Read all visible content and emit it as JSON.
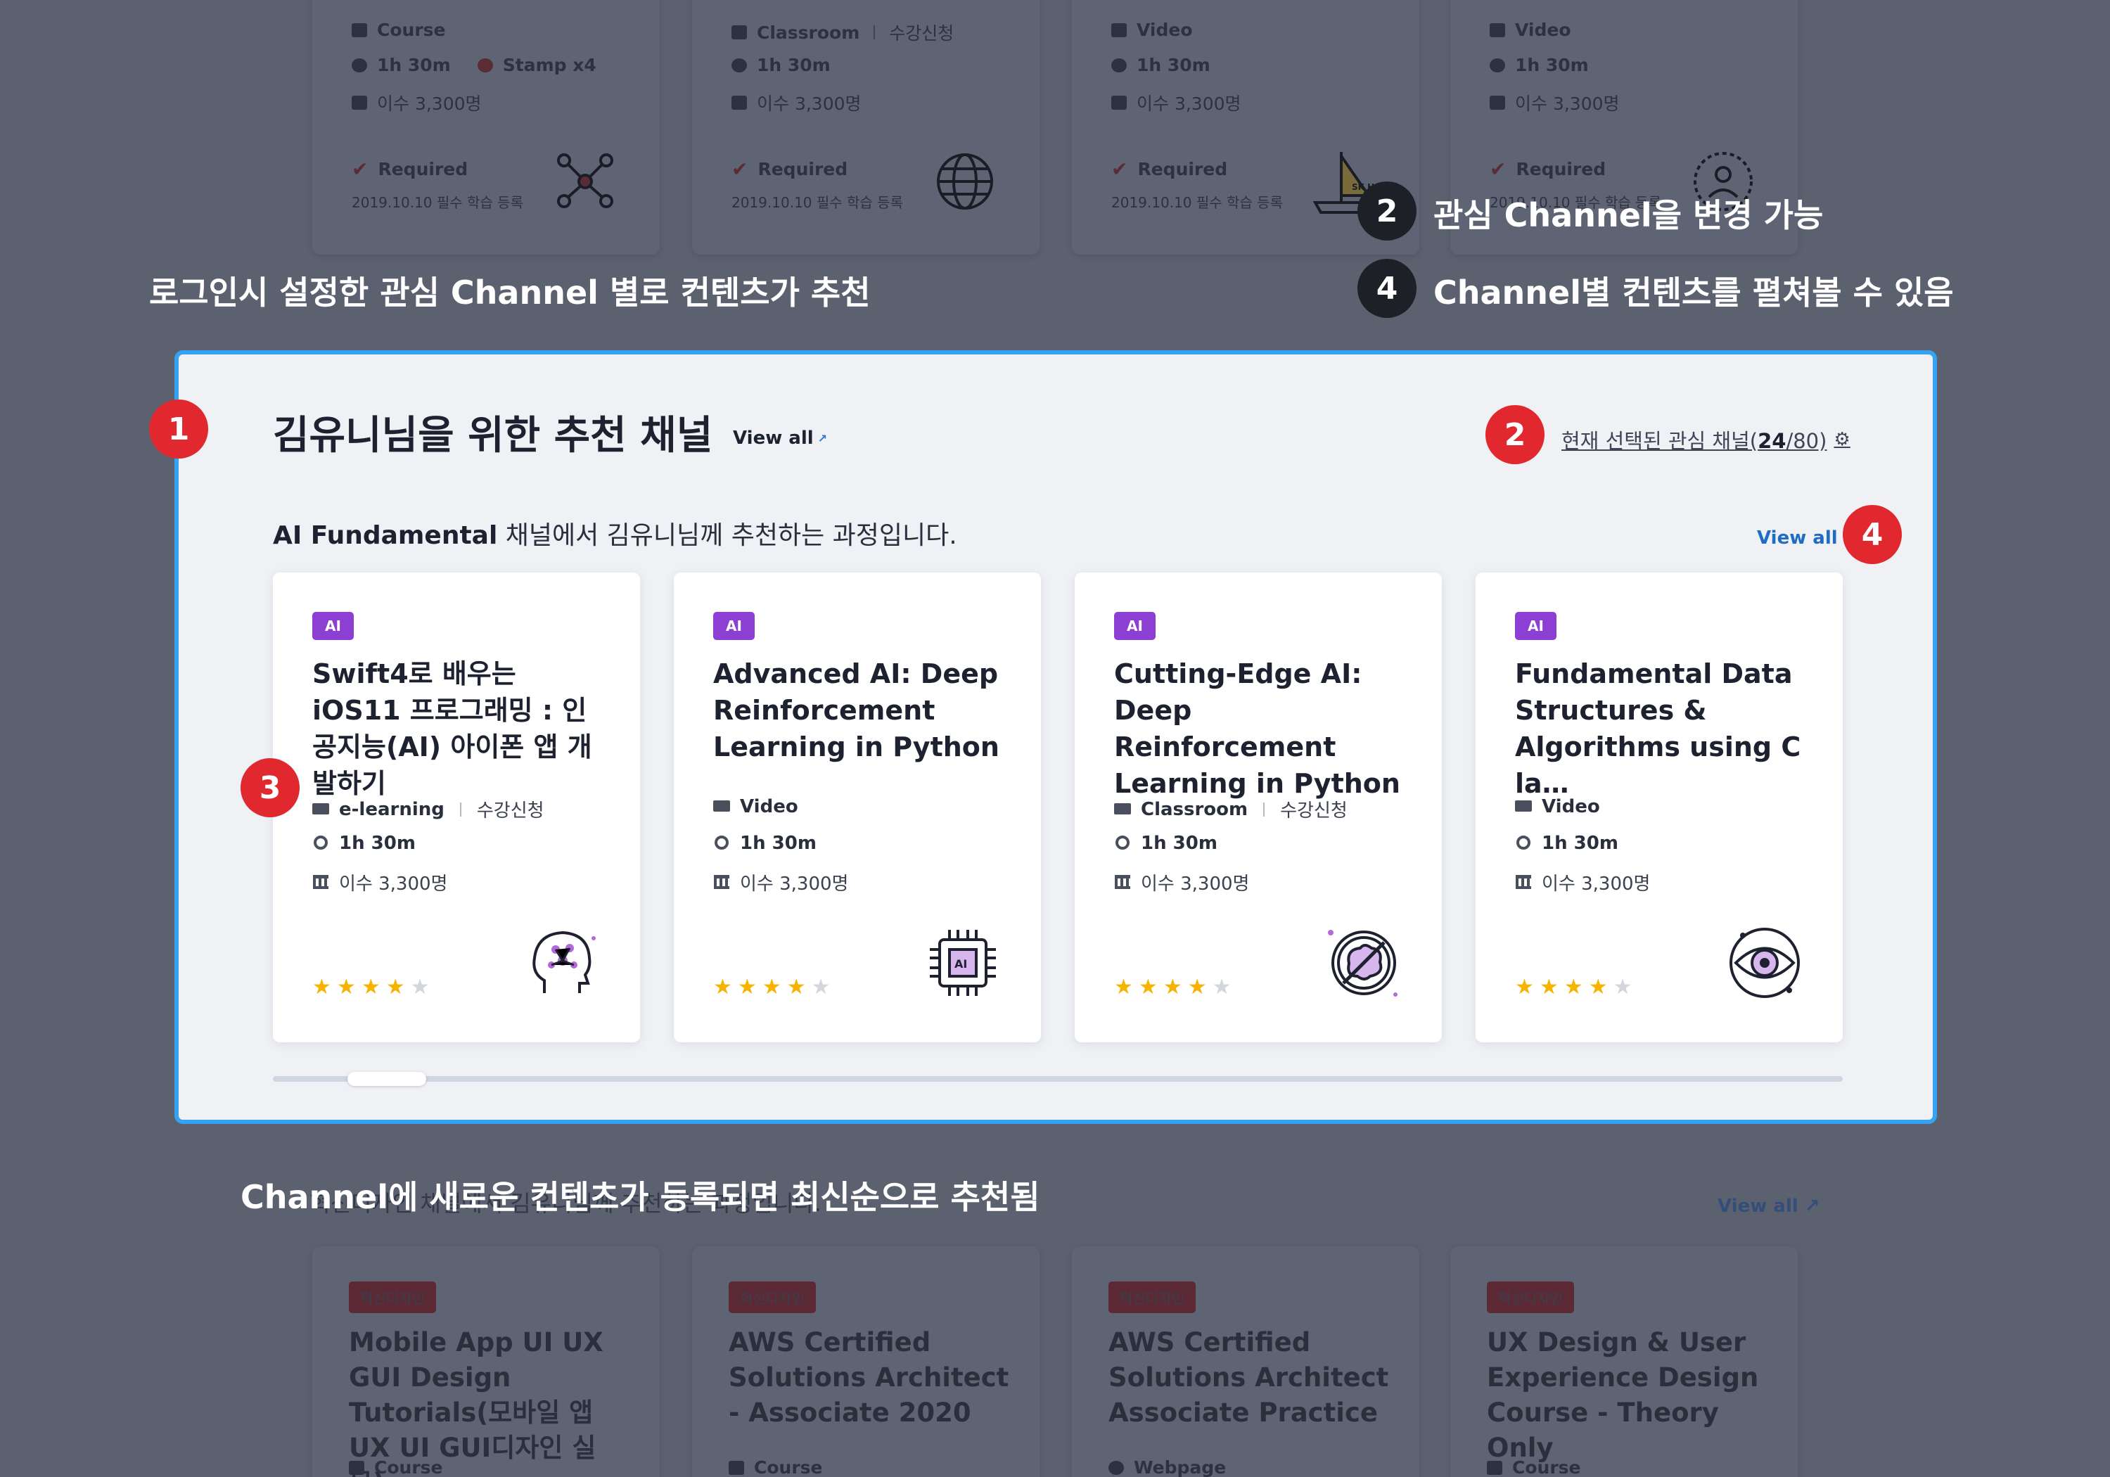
{
  "top_cards": [
    {
      "type": "Course",
      "duration": "1h 30m",
      "extra": "Stamp x4",
      "enrolled": "이수 3,300명",
      "required": "Required",
      "required_date": "2019.10.10 필수 학습 등록",
      "icon": "network-people-icon"
    },
    {
      "type": "Classroom",
      "type_extra": "수강신청",
      "duration": "1h 30m",
      "enrolled": "이수 3,300명",
      "required": "Required",
      "required_date": "2019.10.10 필수 학습 등록",
      "icon": "globe-icon"
    },
    {
      "type": "Video",
      "duration": "1h 30m",
      "enrolled": "이수 3,300명",
      "required": "Required",
      "required_date": "2019.10.10 필수 학습 등록",
      "icon": "sailboat-icon",
      "icon_text": "SK HAPPY"
    },
    {
      "type": "Video",
      "duration": "1h 30m",
      "enrolled": "이수 3,300명",
      "required": "Required",
      "required_date": "2019.10.10 필수 학습 등록",
      "icon": "person-target-icon"
    }
  ],
  "annotations": {
    "left_caption": "로그인시 설정한 관심 Channel 별로 컨텐츠가 추천",
    "step2_number": "2",
    "step2_text": "관심 Channel을 변경 가능",
    "step4_number": "4",
    "step4_text": "Channel별 컨텐츠를 펼쳐볼 수 있음",
    "bottom_caption": "Channel에 새로운 컨텐츠가 등록되면 최신순으로 추천됨",
    "badge1": "1",
    "badge2": "2",
    "badge3": "3",
    "badge4": "4"
  },
  "panel": {
    "title": "김유니님을 위한 추천 채널",
    "view_all": "View all",
    "selected_channel_prefix": "현재 선택된 관심 채널(",
    "selected_count": "24",
    "selected_total": "/80)",
    "subtitle_channel": "AI Fundamental",
    "subtitle_rest": " 채널에서 김유니님께 추천하는 과정입니다.",
    "view_all_right": "View all",
    "cards": [
      {
        "tag": "AI",
        "title": "Swift4로 배우는 iOS11 프로그래밍 : 인공지능(AI) 아이폰 앱 개발하기",
        "type": "e-learning",
        "type_extra": "수강신청",
        "duration": "1h 30m",
        "enrolled": "이수 3,300명",
        "rating": 4,
        "icon": "brain-head-icon"
      },
      {
        "tag": "AI",
        "title": "Advanced AI: Deep Reinforcement Learning in Python",
        "type": "Video",
        "type_extra": "",
        "duration": "1h 30m",
        "enrolled": "이수 3,300명",
        "rating": 4,
        "icon": "ai-chip-icon"
      },
      {
        "tag": "AI",
        "title": "Cutting-Edge AI: Deep Reinforcement Learning in Python",
        "type": "Classroom",
        "type_extra": "수강신청",
        "duration": "1h 30m",
        "enrolled": "이수 3,300명",
        "rating": 4,
        "icon": "brain-circle-icon"
      },
      {
        "tag": "AI",
        "title": "Fundamental Data Structures & Algorithms using C la…",
        "type": "Video",
        "type_extra": "",
        "duration": "1h 30m",
        "enrolled": "이수 3,300명",
        "rating": 4,
        "icon": "eye-icon"
      }
    ],
    "scroll_position": 0.05
  },
  "bottom_section": {
    "subtitle": "혁신디자인 채널에서 김유니님께 추천하는 과정입니다.",
    "view_all": "View all",
    "cards": [
      {
        "tag": "혁신디자인",
        "title": "Mobile App UI UX GUI Design Tutorials(모바일 앱 UX UI GUI디자인 실무)",
        "type": "Course"
      },
      {
        "tag": "혁신디자인",
        "title": "AWS Certified Solutions Architect - Associate 2020",
        "type": "Course"
      },
      {
        "tag": "혁신디자인",
        "title": "AWS Certified Solutions Architect Associate Practice",
        "type": "Webpage"
      },
      {
        "tag": "혁신디자인",
        "title": "UX Design & User Experience Design Course - Theory Only",
        "type": "Course"
      }
    ]
  },
  "colors": {
    "overlay_bg": "#5c6170",
    "panel_border": "#35a3f1",
    "tag_ai": "#8c3fd2",
    "badge_red": "#e0282e",
    "badge_dark": "#1d2026",
    "star": "#f6b400",
    "link_blue": "#1f6cc5"
  }
}
